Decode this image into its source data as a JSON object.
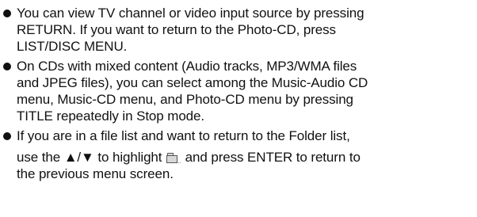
{
  "document": {
    "bullets": [
      {
        "lines": [
          "You can view TV channel or video input source by pressing",
          "RETURN. If you want to return to the Photo-CD, press",
          "LIST/DISC MENU."
        ]
      },
      {
        "lines": [
          "On CDs with mixed content (Audio tracks, MP3/WMA files",
          "and JPEG files), you can select among the Music-Audio CD",
          "menu, Music-CD menu, and Photo-CD menu by pressing",
          "TITLE repeatedly in Stop mode."
        ]
      },
      {
        "line1": "If you are in a file list and want to return to the Folder list,",
        "line2_before_icon": "use the ▲/▼ to highlight",
        "line2_after_icon": "and press ENTER to return to",
        "line3": "the previous menu screen."
      }
    ],
    "icons": {
      "bullet": "bullet-dot-icon",
      "folder": "folder-up-icon"
    }
  }
}
